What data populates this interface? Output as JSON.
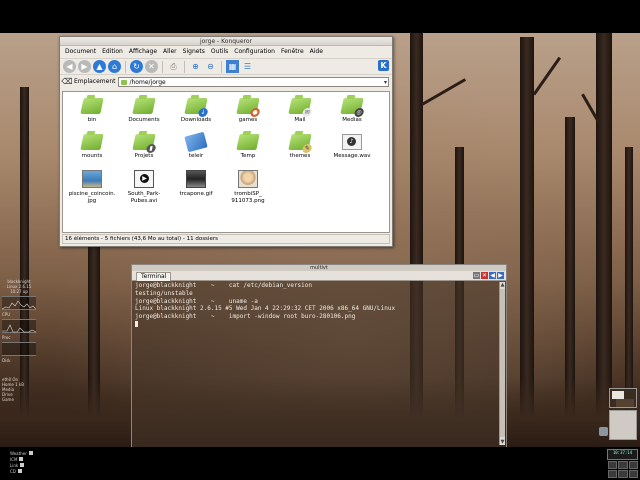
{
  "konqueror": {
    "title": "jorge - Konqueror",
    "menu": [
      "Document",
      "Edition",
      "Affichage",
      "Aller",
      "Signets",
      "Outils",
      "Configuration",
      "Fenêtre",
      "Aide"
    ],
    "location_label": "Emplacement",
    "location_value": "/home/jorge",
    "files": [
      {
        "label": "bin",
        "icon": "folder-icon"
      },
      {
        "label": "Documents",
        "icon": "folder-icon"
      },
      {
        "label": "Downloads",
        "icon": "folder-download-icon"
      },
      {
        "label": "games",
        "icon": "folder-games-icon"
      },
      {
        "label": "Mail",
        "icon": "folder-mail-icon"
      },
      {
        "label": "Medias",
        "icon": "folder-media-icon"
      },
      {
        "label": "mounts",
        "icon": "folder-icon"
      },
      {
        "label": "Projets",
        "icon": "folder-projects-icon"
      },
      {
        "label": "teleir",
        "icon": "link-icon"
      },
      {
        "label": "Temp",
        "icon": "folder-icon"
      },
      {
        "label": "themes",
        "icon": "folder-themes-icon"
      },
      {
        "label": "Message.wav",
        "icon": "audio-file-icon"
      },
      {
        "label": "piscine_coincoin.\njpg",
        "icon": "image-file-icon"
      },
      {
        "label": "South_Park-\nPubes.avi",
        "icon": "video-file-icon"
      },
      {
        "label": "trcapone.gif",
        "icon": "image-file-icon"
      },
      {
        "label": "trombiSP_\n911073.png",
        "icon": "image-file-icon"
      }
    ],
    "status": "16 éléments - 5 fichiers (43,6 Mo au total) - 11 dossiers"
  },
  "terminal": {
    "title": "multivt",
    "tab": "Terminal",
    "lines": [
      "jorge@blackknight    ~    cat /etc/debian_version",
      "testing/unstable",
      "jorge@blackknight    ~    uname -a",
      "Linux blackknight 2.6.15 #5 Wed Jan 4 22:29:32 CET 2006 x86_64 GNU/Linux",
      "jorge@blackknight    ~    import -window root buro-280106.png"
    ]
  },
  "monitor": {
    "host": "blackknight",
    "kernel": "Linux 2.6.15",
    "uptime": "10:27 up",
    "cpu_label": "CPU",
    "proc_label": "Proc",
    "disk_label": "Disk",
    "net_items": [
      "eth0 On",
      "Home 1 kB",
      "Media",
      "Drive",
      "Game"
    ],
    "bottom_items": [
      "Weather",
      "ICM",
      "Link",
      "CD"
    ]
  },
  "clock": "10:37:14",
  "colors": {
    "wallpaper_mid": "#a8886c",
    "terminal_text": "#f2ece4",
    "folder_green": "#8bc44a",
    "window_bg": "#eeeae4"
  }
}
